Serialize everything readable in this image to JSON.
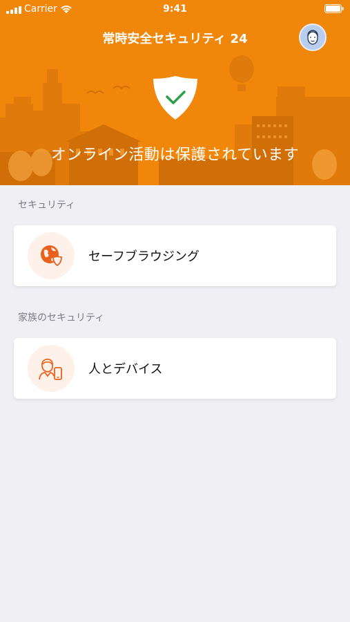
{
  "status_bar": {
    "carrier": "Carrier",
    "time": "9:41"
  },
  "header": {
    "title": "常時安全セキュリティ 24"
  },
  "hero": {
    "status_text": "オンライン活動は保護されています"
  },
  "sections": [
    {
      "label": "セキュリティ",
      "card_label": "セーフブラウジング",
      "icon": "globe-shield-icon"
    },
    {
      "label": "家族のセキュリティ",
      "card_label": "人とデバイス",
      "icon": "person-device-icon"
    }
  ],
  "colors": {
    "accent": "#f0870a",
    "background": "#efeff4",
    "icon_tint": "#e8621d",
    "check": "#2e9e4a"
  }
}
